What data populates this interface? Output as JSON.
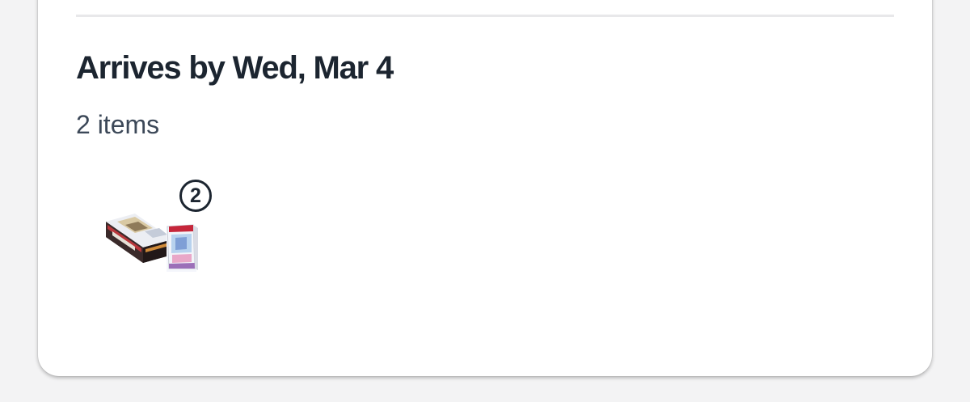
{
  "shipment": {
    "arrival_title": "Arrives by Wed, Mar 4",
    "item_count_label": "2 items",
    "quantity_badge": "2",
    "product_thumbnail_icon": "trading-card-box-bundle-icon"
  },
  "colors": {
    "heading": "#1c2530",
    "subtext": "#3c4858",
    "divider": "#e8e8ea",
    "card_background": "#ffffff",
    "page_background": "#f3f3f4"
  }
}
